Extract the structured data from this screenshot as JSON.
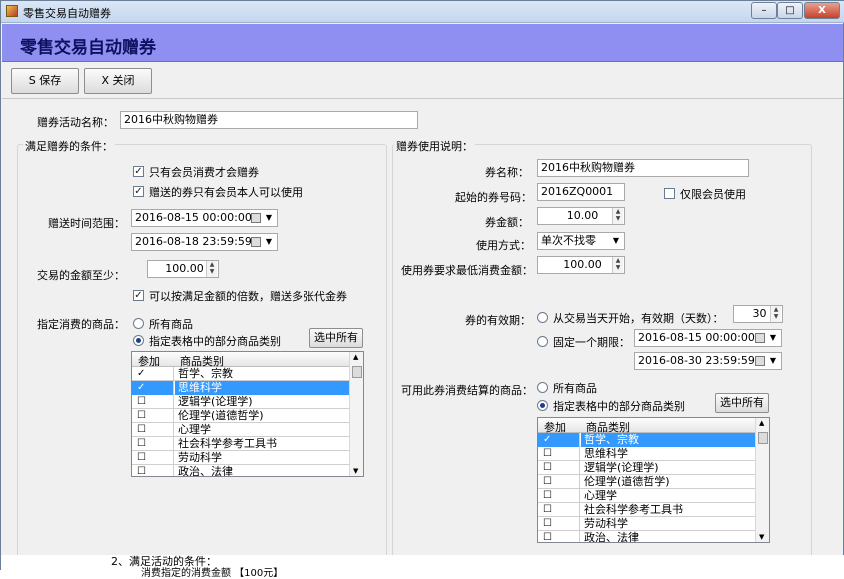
{
  "window": {
    "title": "零售交易自动赠券",
    "min": "–",
    "max": "□",
    "close": "X"
  },
  "header": {
    "title": "零售交易自动赠券"
  },
  "toolbar": {
    "save": "S 保存",
    "close": "X 关闭"
  },
  "activity": {
    "label": "赠券活动名称：",
    "value": "2016中秋购物赠券"
  },
  "conditions": {
    "title": "满足赠券的条件：",
    "member_only": {
      "label": "只有会员消费才会赠券",
      "checked": true
    },
    "member_self": {
      "label": "赠送的券只有会员本人可以使用",
      "checked": true
    },
    "time_label": "赠送时间范围：",
    "time_from": "2016-08-15 00:00:00",
    "time_to": "2016-08-18 23:59:59",
    "min_amount_label": "交易的金额至少：",
    "min_amount": "100.00",
    "multiple": {
      "label": "可以按满足金额的倍数，赠送多张代金券",
      "checked": true
    },
    "goods_label": "指定消费的商品：",
    "all_goods": "所有商品",
    "partial_goods": "指定表格中的部分商品类别",
    "select_all": "选中所有",
    "grid_headers": [
      "参加",
      "商品类别"
    ],
    "grid_rows": [
      {
        "check": "✓",
        "name": "哲学、宗教"
      },
      {
        "check": "✓",
        "name": "思维科学"
      },
      {
        "check": "☐",
        "name": "逻辑学(论理学)"
      },
      {
        "check": "☐",
        "name": "伦理学(道德哲学)"
      },
      {
        "check": "☐",
        "name": "心理学"
      },
      {
        "check": "☐",
        "name": "社会科学参考工具书"
      },
      {
        "check": "☐",
        "name": "劳动科学"
      },
      {
        "check": "☐",
        "name": "政治、法律"
      }
    ]
  },
  "usage": {
    "title": "赠券使用说明：",
    "coupon_name_label": "券名称：",
    "coupon_name": "2016中秋购物赠券",
    "start_no_label": "起始的券号码：",
    "start_no": "2016ZQ0001",
    "member_use": "仅限会员使用",
    "amount_label": "券金额：",
    "amount": "10.00",
    "method_label": "使用方式：",
    "method": "单次不找零",
    "min_spend_label": "使用券要求最低消费金额：",
    "min_spend": "100.00",
    "validity_label": "券的有效期：",
    "from_today": "从交易当天开始，有效期（天数）：",
    "days": "30",
    "fixed": "固定一个期限：",
    "fixed_from": "2016-08-15 00:00:00",
    "fixed_to": "2016-08-30 23:59:59",
    "goods_label": "可用此券消费结算的商品：",
    "all_goods": "所有商品",
    "partial_goods": "指定表格中的部分商品类别",
    "select_all": "选中所有",
    "grid_headers": [
      "参加",
      "商品类别"
    ],
    "grid_rows": [
      {
        "check": "✓",
        "name": "哲学、宗教"
      },
      {
        "check": "☐",
        "name": "思维科学"
      },
      {
        "check": "☐",
        "name": "逻辑学(论理学)"
      },
      {
        "check": "☐",
        "name": "伦理学(道德哲学)"
      },
      {
        "check": "☐",
        "name": "心理学"
      },
      {
        "check": "☐",
        "name": "社会科学参考工具书"
      },
      {
        "check": "☐",
        "name": "劳动科学"
      },
      {
        "check": "☐",
        "name": "政治、法律"
      }
    ]
  },
  "footer": {
    "note1": "2、满足活动的条件：",
    "note2": "消费指定的消费金额 【100元】"
  },
  "icons": {
    "calendar": "calendar-icon",
    "dropdown": "chevron-down-icon",
    "spin": "spin-updown-icon"
  }
}
